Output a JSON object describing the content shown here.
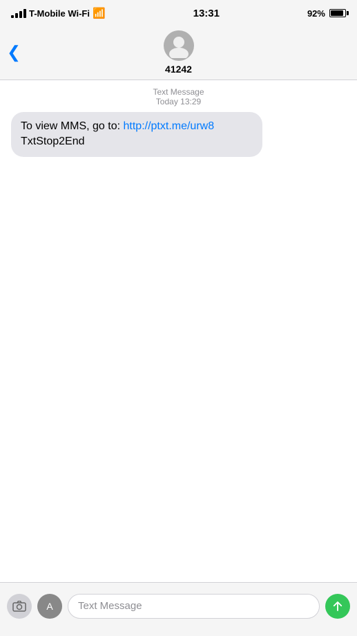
{
  "statusBar": {
    "carrier": "T-Mobile Wi-Fi",
    "time": "13:31",
    "battery": "92%"
  },
  "navBar": {
    "contactNumber": "41242"
  },
  "messageThread": {
    "timestampLabel": "Text Message",
    "timestampDate": "Today 13:29",
    "messages": [
      {
        "text_before_link": "To view MMS, go to: ",
        "link_text": "http://ptxt.me/urw8",
        "link_url": "http://ptxt.me/urw8",
        "text_after_link": "\nTxtStop2End",
        "sender": "them"
      }
    ]
  },
  "inputBar": {
    "placeholder": "Text Message"
  }
}
